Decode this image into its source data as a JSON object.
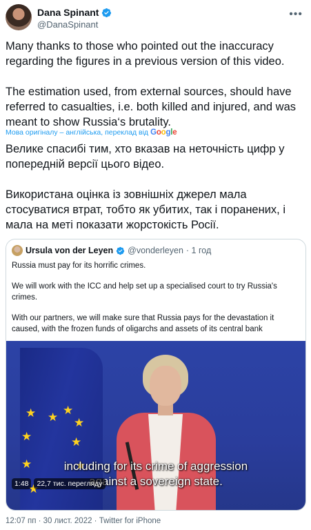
{
  "author": {
    "name": "Dana Spinant",
    "handle": "@DanaSpinant"
  },
  "tweet": {
    "paragraph1": "Many thanks to those who pointed out the inaccuracy regarding the figures in a previous version of this video.",
    "paragraph2": "The estimation used, from external sources, should have referred to casualties, i.e. both killed and injured, and was meant to show Russia‘s brutality."
  },
  "translation": {
    "note_prefix": "Мова оригіналу – англійська, переклад від",
    "google": [
      "G",
      "o",
      "o",
      "g",
      "l",
      "e"
    ],
    "paragraph1": "Велике спасибі тим, хто вказав на неточність цифр у попередній версії цього відео.",
    "paragraph2": "Використана оцінка із зовнішніх джерел мала стосуватися втрат, тобто як убитих, так і поранених, і мала на меті показати жорстокість Росії."
  },
  "quoted": {
    "name": "Ursula von der Leyen",
    "handle": "@vonderleyen",
    "time": "· 1 год",
    "paragraph1": "Russia must pay for its horrific crimes.",
    "paragraph2": "We will work with the ICC and help set up a specialised court to try Russia's crimes.",
    "paragraph3": "With our partners, we will make sure that Russia pays for the devastation it caused, with the frozen funds of oligarchs and assets of its central bank",
    "video": {
      "subtitle1": "including for its crime of aggression",
      "subtitle2": "against a sovereign state.",
      "duration": "1:48",
      "views": "22,7 тис. перегляду"
    }
  },
  "meta": "12:07 пп · 30 лист. 2022 · Twitter for iPhone",
  "colors": {
    "accent": "#1d9bf0",
    "muted": "#536471",
    "text": "#0f1419",
    "border": "#cfd9de"
  }
}
